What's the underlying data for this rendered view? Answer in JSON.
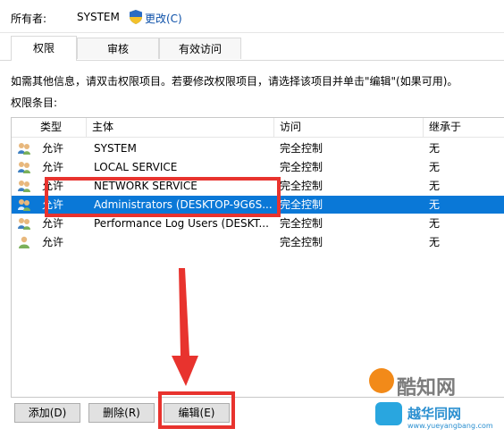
{
  "owner": {
    "label": "所有者:",
    "value": "SYSTEM",
    "change_link": "更改(C)"
  },
  "tabs": [
    {
      "label": "权限",
      "active": true
    },
    {
      "label": "审核",
      "active": false
    },
    {
      "label": "有效访问",
      "active": false
    }
  ],
  "info_text": "如需其他信息，请双击权限项目。若要修改权限项目，请选择该项目并单击\"编辑\"(如果可用)。",
  "entries_label": "权限条目:",
  "columns": {
    "type": "类型",
    "principal": "主体",
    "access": "访问",
    "inherited": "继承于"
  },
  "rows": [
    {
      "type": "允许",
      "principal": "SYSTEM",
      "access": "完全控制",
      "inherited": "无",
      "selected": false
    },
    {
      "type": "允许",
      "principal": "LOCAL SERVICE",
      "access": "完全控制",
      "inherited": "无",
      "selected": false
    },
    {
      "type": "允许",
      "principal": "NETWORK SERVICE",
      "access": "完全控制",
      "inherited": "无",
      "selected": false
    },
    {
      "type": "允许",
      "principal": "Administrators (DESKTOP-9G6S...",
      "access": "完全控制",
      "inherited": "无",
      "selected": true
    },
    {
      "type": "允许",
      "principal": "Performance Log Users (DESKT...",
      "access": "完全控制",
      "inherited": "无",
      "selected": false
    },
    {
      "type": "允许",
      "principal": "",
      "access": "完全控制",
      "inherited": "无",
      "selected": false
    }
  ],
  "buttons": {
    "add": "添加(D)",
    "remove": "删除(R)",
    "edit": "编辑(E)"
  },
  "watermark": {
    "brand1": "酷知网",
    "brand2": "越华同网",
    "url": "www.yueyangbang.com"
  },
  "colors": {
    "selection": "#0a78d7",
    "highlight": "#e8332e",
    "link": "#0b4fa8"
  }
}
